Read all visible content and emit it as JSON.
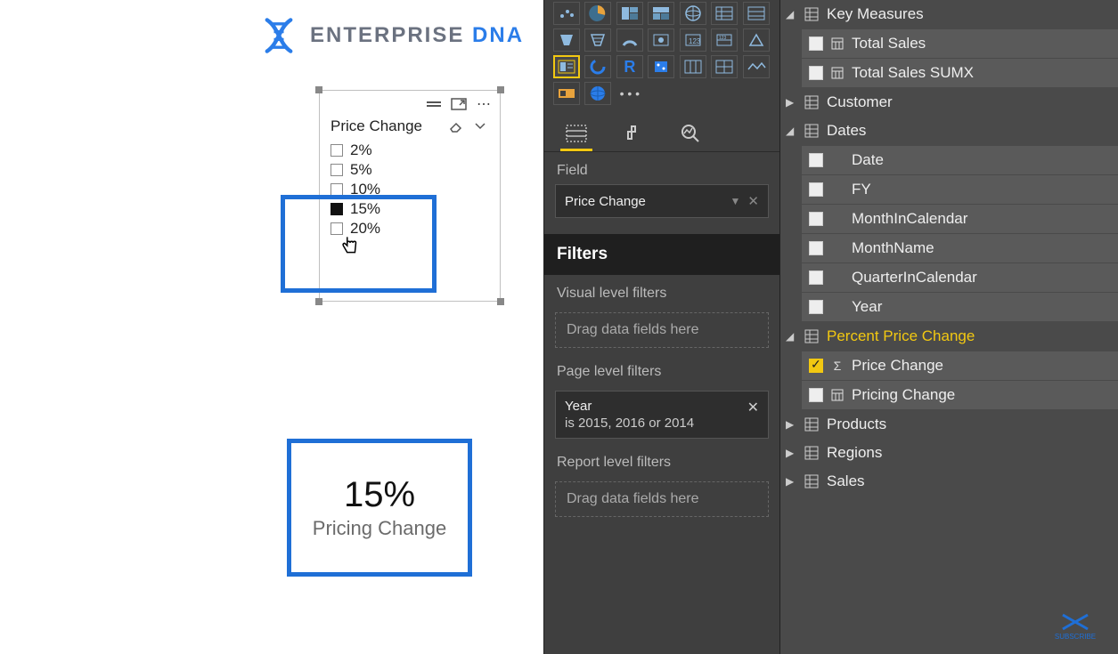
{
  "logo": {
    "text_main": "ENTERPRISE ",
    "text_accent": "DNA"
  },
  "slicer": {
    "title": "Price Change",
    "items": [
      {
        "label": "2%",
        "checked": false
      },
      {
        "label": "5%",
        "checked": false
      },
      {
        "label": "10%",
        "checked": false
      },
      {
        "label": "15%",
        "checked": true
      },
      {
        "label": "20%",
        "checked": false
      }
    ]
  },
  "card": {
    "value": "15%",
    "label": "Pricing Change"
  },
  "viz_panel": {
    "field_section_label": "Field",
    "field_well_value": "Price Change",
    "filters_header": "Filters",
    "visual_filters_label": "Visual level filters",
    "visual_filters_placeholder": "Drag data fields here",
    "page_filters_label": "Page level filters",
    "page_filter": {
      "title": "Year",
      "subtitle": "is 2015, 2016 or 2014"
    },
    "report_filters_label": "Report level filters",
    "report_filters_placeholder": "Drag data fields here"
  },
  "fields_panel": {
    "tables": [
      {
        "name": "Key Measures",
        "expanded": true,
        "fields": [
          {
            "name": "Total Sales",
            "icon": "calc",
            "checked": false
          },
          {
            "name": "Total Sales SUMX",
            "icon": "calc",
            "checked": false
          }
        ]
      },
      {
        "name": "Customer",
        "expanded": false,
        "fields": []
      },
      {
        "name": "Dates",
        "expanded": true,
        "fields": [
          {
            "name": "Date",
            "icon": "",
            "checked": false
          },
          {
            "name": "FY",
            "icon": "",
            "checked": false
          },
          {
            "name": "MonthInCalendar",
            "icon": "",
            "checked": false
          },
          {
            "name": "MonthName",
            "icon": "",
            "checked": false
          },
          {
            "name": "QuarterInCalendar",
            "icon": "",
            "checked": false
          },
          {
            "name": "Year",
            "icon": "",
            "checked": false
          }
        ]
      },
      {
        "name": "Percent Price Change",
        "expanded": true,
        "highlight": true,
        "fields": [
          {
            "name": "Price Change",
            "icon": "sigma",
            "checked": true
          },
          {
            "name": "Pricing Change",
            "icon": "calc",
            "checked": false
          }
        ]
      },
      {
        "name": "Products",
        "expanded": false,
        "fields": []
      },
      {
        "name": "Regions",
        "expanded": false,
        "fields": []
      },
      {
        "name": "Sales",
        "expanded": false,
        "fields": []
      }
    ]
  },
  "subscribe": {
    "label": "SUBSCRIBE"
  }
}
